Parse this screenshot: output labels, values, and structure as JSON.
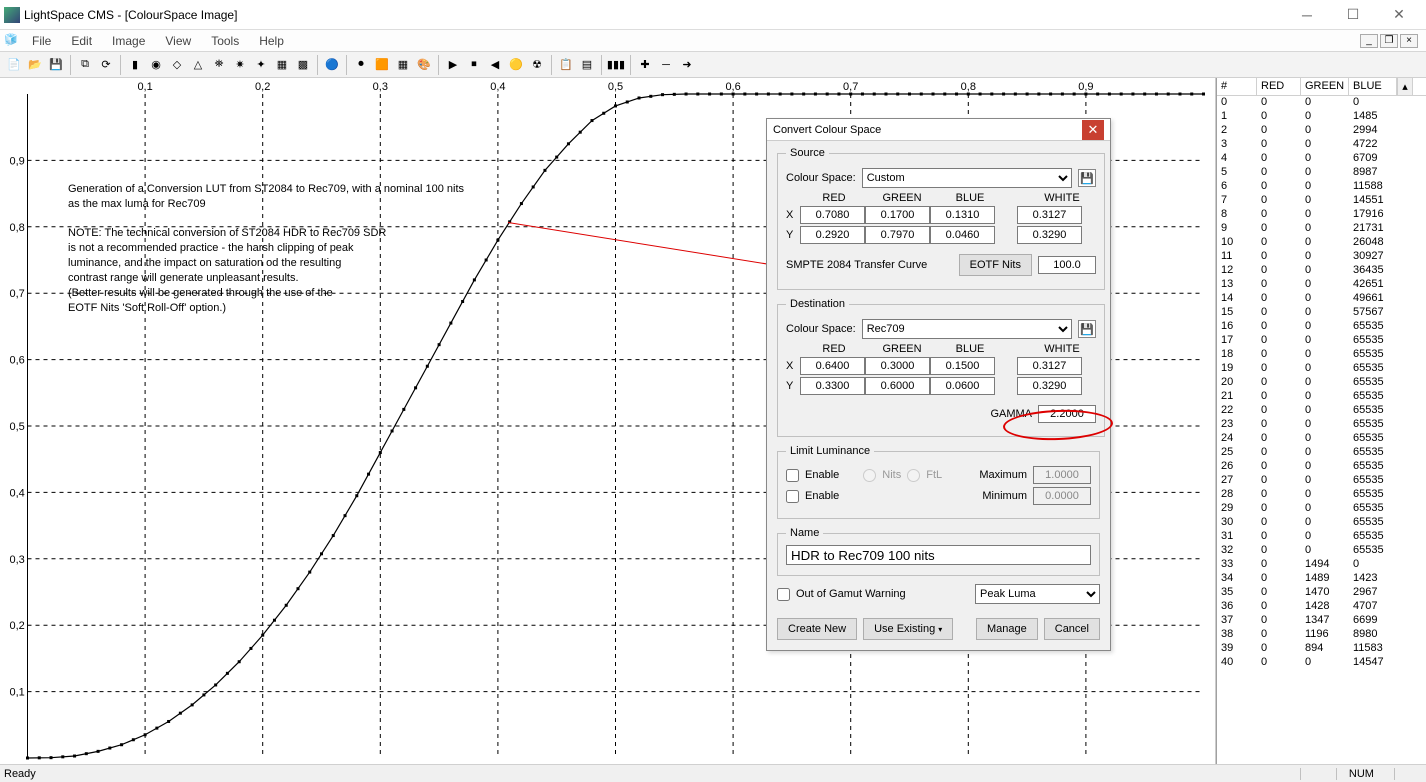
{
  "window_title": "LightSpace CMS - [ColourSpace Image]",
  "menus": [
    "File",
    "Edit",
    "Image",
    "View",
    "Tools",
    "Help"
  ],
  "status_ready": "Ready",
  "status_num": "NUM",
  "notes": {
    "l1": "Generation of a Conversion LUT from ST2084 to Rec709, with a nominal 100 nits",
    "l2": "as the max luma for Rec709",
    "l3": "NOTE: The technical conversion of ST2084 HDR to Rec709 SDR",
    "l4": "is not a recommended practice - the harsh clipping of peak",
    "l5": "luminance, and the impact on saturation od the resulting",
    "l6": "contrast range will generate unpleasant results.",
    "l7": "(Better results will be generated through the use of the",
    "l8": "EOTF Nits 'Soft Roll-Off' option.)"
  },
  "chart_data": {
    "type": "line",
    "title": "",
    "xlabel": "",
    "ylabel": "",
    "xlim": [
      0,
      1.0
    ],
    "ylim": [
      0,
      1.0
    ],
    "x_ticks": [
      "0,1",
      "0,2",
      "0,3",
      "0,4",
      "0,5",
      "0,6",
      "0,7",
      "0,8",
      "0,9"
    ],
    "y_ticks": [
      "0,1",
      "0,2",
      "0,3",
      "0,4",
      "0,5",
      "0,6",
      "0,7",
      "0,8",
      "0,9"
    ],
    "series": [
      {
        "name": "lut",
        "x": [
          0,
          0.02,
          0.04,
          0.06,
          0.08,
          0.1,
          0.12,
          0.14,
          0.16,
          0.18,
          0.2,
          0.22,
          0.24,
          0.26,
          0.28,
          0.3,
          0.32,
          0.34,
          0.36,
          0.38,
          0.4,
          0.42,
          0.44,
          0.46,
          0.48,
          0.5,
          0.52,
          0.54,
          0.56,
          0.58,
          0.6,
          1.0
        ],
        "y": [
          0,
          0.0005,
          0.003,
          0.01,
          0.02,
          0.035,
          0.055,
          0.08,
          0.11,
          0.145,
          0.185,
          0.23,
          0.28,
          0.335,
          0.395,
          0.46,
          0.525,
          0.59,
          0.655,
          0.72,
          0.78,
          0.835,
          0.885,
          0.925,
          0.96,
          0.982,
          0.994,
          0.999,
          1.0,
          1.0,
          1.0,
          1.0
        ]
      }
    ]
  },
  "dialog": {
    "title": "Convert Colour Space",
    "source": {
      "legend": "Source",
      "cs_label": "Colour Space:",
      "cs_value": "Custom",
      "col_red": "RED",
      "col_green": "GREEN",
      "col_blue": "BLUE",
      "col_white": "WHITE",
      "x": {
        "r": "0.7080",
        "g": "0.1700",
        "b": "0.1310",
        "w": "0.3127"
      },
      "y": {
        "r": "0.2920",
        "g": "0.7970",
        "b": "0.0460",
        "w": "0.3290"
      },
      "curve_label": "SMPTE 2084 Transfer Curve",
      "eotf_btn": "EOTF Nits",
      "eotf_val": "100.0"
    },
    "dest": {
      "legend": "Destination",
      "cs_value": "Rec709",
      "x": {
        "r": "0.6400",
        "g": "0.3000",
        "b": "0.1500",
        "w": "0.3127"
      },
      "y": {
        "r": "0.3300",
        "g": "0.6000",
        "b": "0.0600",
        "w": "0.3290"
      },
      "gamma_label": "GAMMA",
      "gamma_val": "2.2000"
    },
    "limit": {
      "legend": "Limit Luminance",
      "enable": "Enable",
      "nits": "Nits",
      "ftl": "FtL",
      "max": "Maximum",
      "max_val": "1.0000",
      "min": "Minimum",
      "min_val": "0.0000"
    },
    "name": {
      "legend": "Name",
      "val": "HDR to Rec709 100 nits"
    },
    "gamut_label": "Out of Gamut Warning",
    "gamut_drop": "Peak Luma",
    "btns": {
      "create": "Create New",
      "use": "Use Existing",
      "manage": "Manage",
      "cancel": "Cancel"
    }
  },
  "table": {
    "head": {
      "idx": "#",
      "r": "RED",
      "g": "GREEN",
      "b": "BLUE"
    },
    "rows": [
      {
        "i": 0,
        "r": 0,
        "g": 0,
        "b": 0
      },
      {
        "i": 1,
        "r": 0,
        "g": 0,
        "b": 1485
      },
      {
        "i": 2,
        "r": 0,
        "g": 0,
        "b": 2994
      },
      {
        "i": 3,
        "r": 0,
        "g": 0,
        "b": 4722
      },
      {
        "i": 4,
        "r": 0,
        "g": 0,
        "b": 6709
      },
      {
        "i": 5,
        "r": 0,
        "g": 0,
        "b": 8987
      },
      {
        "i": 6,
        "r": 0,
        "g": 0,
        "b": 11588
      },
      {
        "i": 7,
        "r": 0,
        "g": 0,
        "b": 14551
      },
      {
        "i": 8,
        "r": 0,
        "g": 0,
        "b": 17916
      },
      {
        "i": 9,
        "r": 0,
        "g": 0,
        "b": 21731
      },
      {
        "i": 10,
        "r": 0,
        "g": 0,
        "b": 26048
      },
      {
        "i": 11,
        "r": 0,
        "g": 0,
        "b": 30927
      },
      {
        "i": 12,
        "r": 0,
        "g": 0,
        "b": 36435
      },
      {
        "i": 13,
        "r": 0,
        "g": 0,
        "b": 42651
      },
      {
        "i": 14,
        "r": 0,
        "g": 0,
        "b": 49661
      },
      {
        "i": 15,
        "r": 0,
        "g": 0,
        "b": 57567
      },
      {
        "i": 16,
        "r": 0,
        "g": 0,
        "b": 65535
      },
      {
        "i": 17,
        "r": 0,
        "g": 0,
        "b": 65535
      },
      {
        "i": 18,
        "r": 0,
        "g": 0,
        "b": 65535
      },
      {
        "i": 19,
        "r": 0,
        "g": 0,
        "b": 65535
      },
      {
        "i": 20,
        "r": 0,
        "g": 0,
        "b": 65535
      },
      {
        "i": 21,
        "r": 0,
        "g": 0,
        "b": 65535
      },
      {
        "i": 22,
        "r": 0,
        "g": 0,
        "b": 65535
      },
      {
        "i": 23,
        "r": 0,
        "g": 0,
        "b": 65535
      },
      {
        "i": 24,
        "r": 0,
        "g": 0,
        "b": 65535
      },
      {
        "i": 25,
        "r": 0,
        "g": 0,
        "b": 65535
      },
      {
        "i": 26,
        "r": 0,
        "g": 0,
        "b": 65535
      },
      {
        "i": 27,
        "r": 0,
        "g": 0,
        "b": 65535
      },
      {
        "i": 28,
        "r": 0,
        "g": 0,
        "b": 65535
      },
      {
        "i": 29,
        "r": 0,
        "g": 0,
        "b": 65535
      },
      {
        "i": 30,
        "r": 0,
        "g": 0,
        "b": 65535
      },
      {
        "i": 31,
        "r": 0,
        "g": 0,
        "b": 65535
      },
      {
        "i": 32,
        "r": 0,
        "g": 0,
        "b": 65535
      },
      {
        "i": 33,
        "r": 0,
        "g": 1494,
        "b": 0
      },
      {
        "i": 34,
        "r": 0,
        "g": 1489,
        "b": 1423
      },
      {
        "i": 35,
        "r": 0,
        "g": 1470,
        "b": 2967
      },
      {
        "i": 36,
        "r": 0,
        "g": 1428,
        "b": 4707
      },
      {
        "i": 37,
        "r": 0,
        "g": 1347,
        "b": 6699
      },
      {
        "i": 38,
        "r": 0,
        "g": 1196,
        "b": 8980
      },
      {
        "i": 39,
        "r": 0,
        "g": 894,
        "b": 11583
      },
      {
        "i": 40,
        "r": 0,
        "g": 0,
        "b": 14547
      }
    ]
  }
}
